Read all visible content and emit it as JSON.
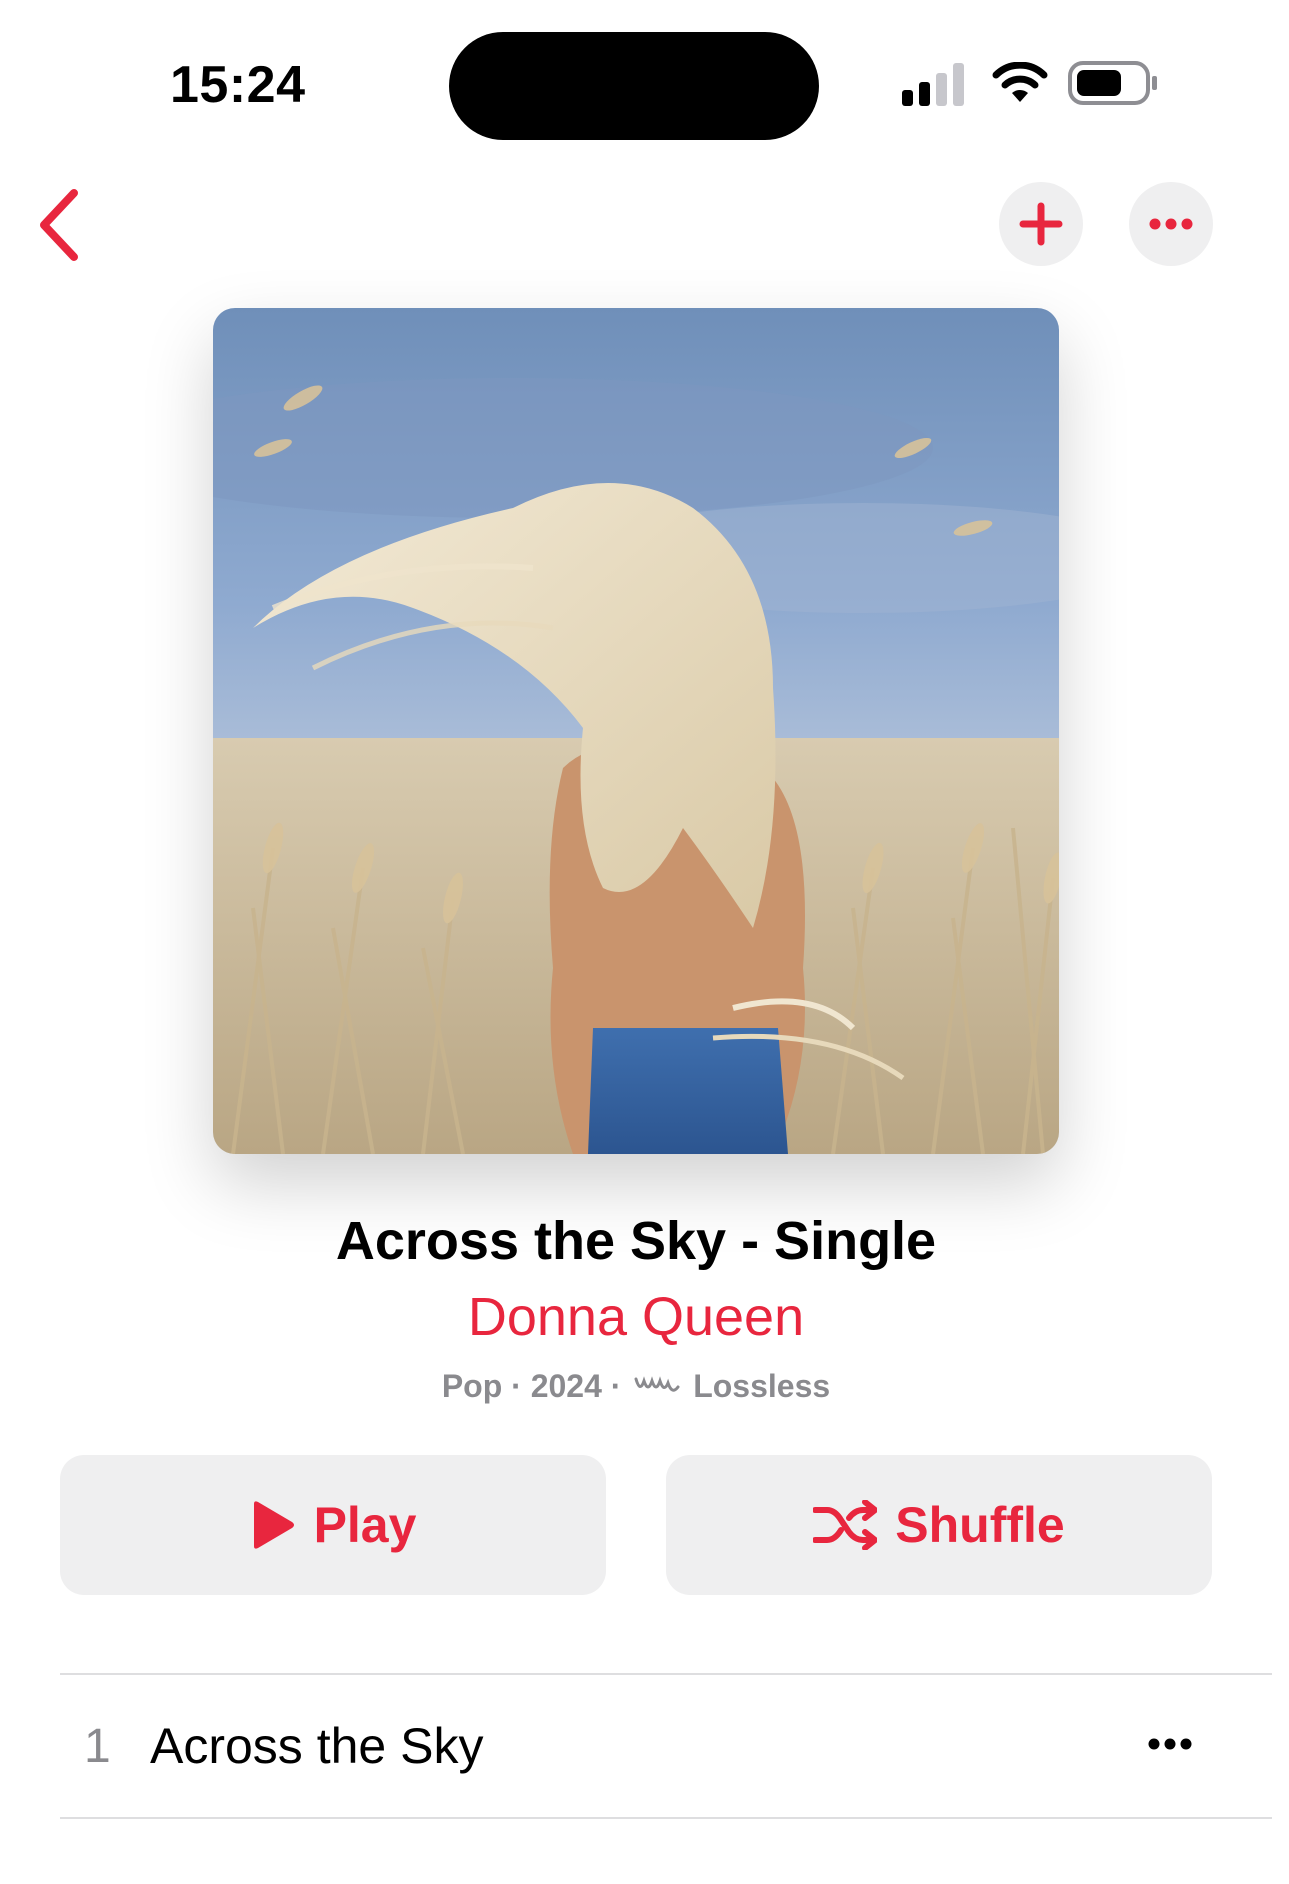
{
  "status_bar": {
    "time": "15:24",
    "icons": [
      "cellular-signal-icon",
      "wifi-icon",
      "battery-icon"
    ]
  },
  "nav": {
    "icons": [
      "chevron-left-icon",
      "plus-icon",
      "ellipsis-icon"
    ]
  },
  "album": {
    "artwork": "album-artwork",
    "title": "Across the Sky - Single",
    "artist": "Donna Queen",
    "genre": "Pop",
    "year": "2024",
    "separator": "·",
    "quality": "Lossless"
  },
  "actions": {
    "play_label": "Play",
    "shuffle_label": "Shuffle"
  },
  "tracks": [
    {
      "number": "1",
      "title": "Across the Sky"
    }
  ],
  "colors": {
    "accent": "#e8263e",
    "button_bg": "#efeff0",
    "secondary_text": "#8a8a8e",
    "divider": "#dedee0"
  }
}
